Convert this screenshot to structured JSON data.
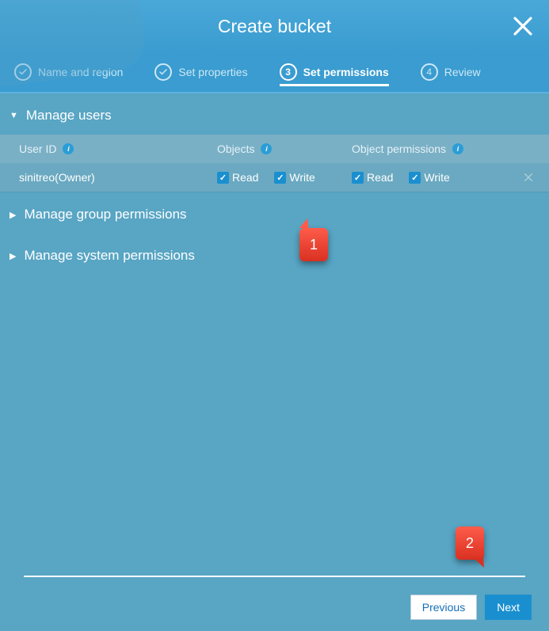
{
  "header": {
    "title": "Create bucket"
  },
  "stepper": {
    "steps": [
      {
        "num": "✓",
        "label": "Name and region",
        "done": true
      },
      {
        "num": "✓",
        "label": "Set properties",
        "done": true
      },
      {
        "num": "3",
        "label": "Set permissions",
        "active": true
      },
      {
        "num": "4",
        "label": "Review"
      }
    ]
  },
  "sections": {
    "manage_users": {
      "title": "Manage users",
      "columns": {
        "user_id": "User ID",
        "objects": "Objects",
        "object_permissions": "Object permissions"
      },
      "rows": [
        {
          "user": "sinitreo(Owner)",
          "obj_read": "Read",
          "obj_write": "Write",
          "perm_read": "Read",
          "perm_write": "Write"
        }
      ]
    },
    "manage_group": {
      "title": "Manage group permissions"
    },
    "manage_system": {
      "title": "Manage system permissions"
    }
  },
  "footer": {
    "previous": "Previous",
    "next": "Next"
  },
  "callouts": {
    "one": "1",
    "two": "2"
  }
}
